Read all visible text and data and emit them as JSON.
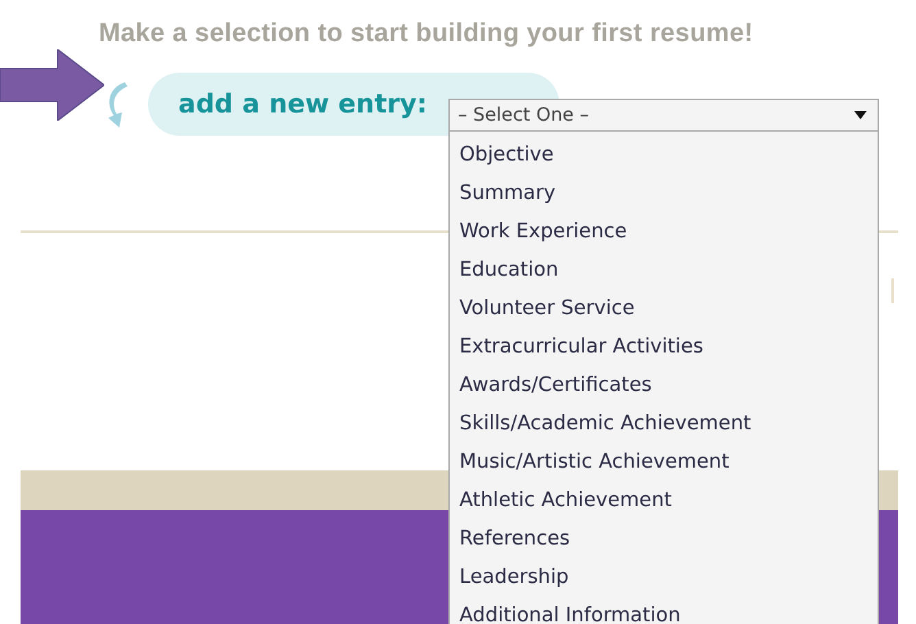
{
  "heading": "Make a selection to start building your first resume!",
  "entry": {
    "label": "add a new entry:",
    "select": {
      "value": "– Select One –",
      "expanded": true,
      "options": [
        "Objective",
        "Summary",
        "Work Experience",
        "Education",
        "Volunteer Service",
        "Extracurricular Activities",
        "Awards/Certificates",
        "Skills/Academic Achievement",
        "Music/Artistic Achievement",
        "Athletic Achievement",
        "References",
        "Leadership",
        "Additional Information"
      ]
    }
  }
}
